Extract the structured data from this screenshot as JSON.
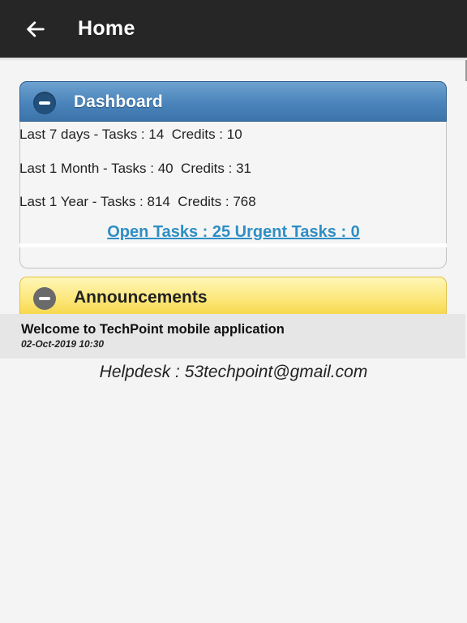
{
  "header": {
    "title": "Home",
    "back_icon": "arrow-left-icon"
  },
  "dashboard": {
    "title": "Dashboard",
    "collapse_icon": "minus-circle-icon",
    "stats": [
      "Last 7 days - Tasks : 14  Credits : 10",
      "Last 1 Month - Tasks : 40  Credits : 31",
      "Last 1 Year - Tasks : 814  Credits : 768"
    ],
    "tasks_link": "Open Tasks : 25 Urgent Tasks : 0",
    "colors": {
      "header": "#4a84bb",
      "link": "#2f8ec4"
    }
  },
  "announcements": {
    "title": "Announcements",
    "collapse_icon": "minus-circle-icon",
    "items": [
      {
        "title": "Welcome to TechPoint mobile application",
        "date": "02-Oct-2019 10:30"
      }
    ],
    "colors": {
      "header": "#fce77a"
    }
  },
  "helpdesk": "Helpdesk : 53techpoint@gmail.com"
}
